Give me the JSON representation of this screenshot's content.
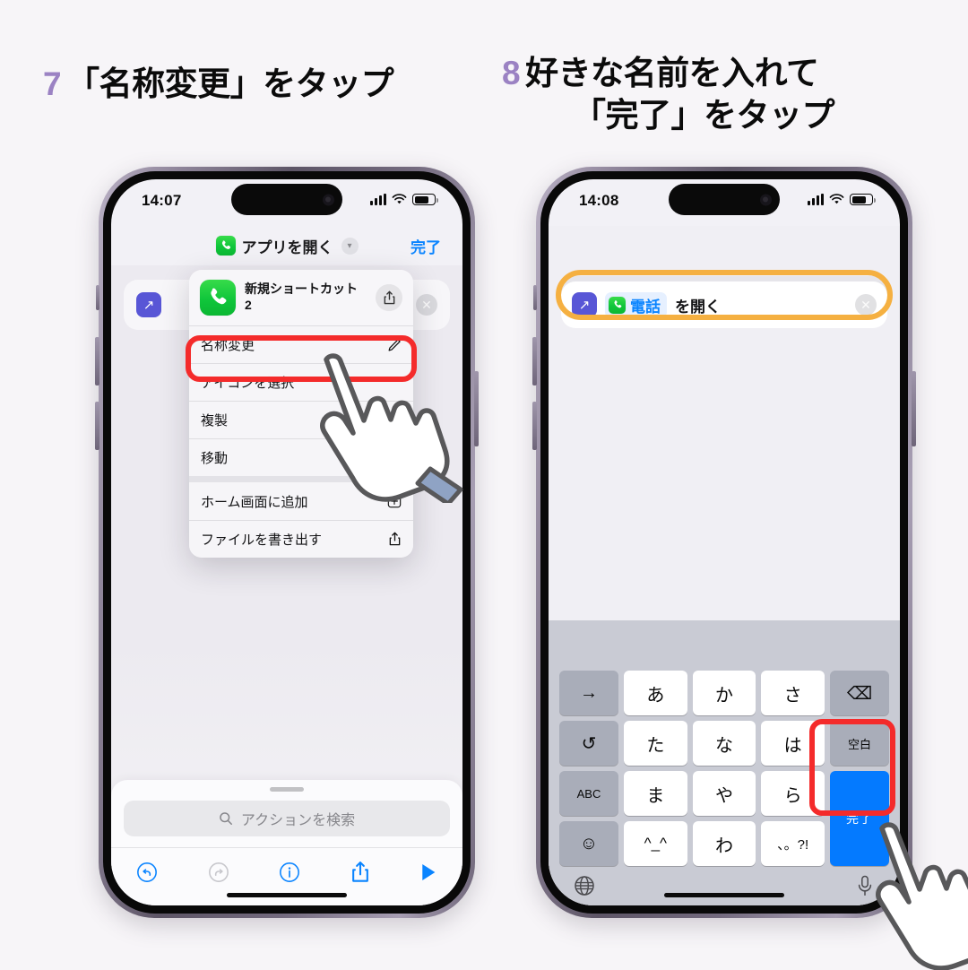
{
  "theme": {
    "background": "#f7f5f8",
    "step_number_color": "#9b82c3",
    "highlight_red": "#f42b2b",
    "highlight_orange": "#f5b041",
    "ios_blue": "#0a84ff",
    "key_done_blue": "#047aff",
    "phone_green": "#10c63b",
    "open_app_purple": "#5856d6"
  },
  "headings": {
    "left": {
      "number": "7",
      "text": "「名称変更」をタップ"
    },
    "right": {
      "number": "8",
      "line1": "好きな名前を入れて",
      "line2": "「完了」をタップ"
    }
  },
  "left_phone": {
    "status": {
      "time": "14:07",
      "signal_icon": "cellular-bars-icon",
      "wifi_icon": "wifi-icon",
      "battery_icon": "battery-icon"
    },
    "nav": {
      "app_icon": "phone-app-icon",
      "title": "アプリを開く",
      "chevron_icon": "chevron-down-icon",
      "done_label": "完了"
    },
    "action_row": {
      "open_glyph_icon": "open-app-arrow-icon",
      "close_icon": "close-circle-icon"
    },
    "context_menu": {
      "header": {
        "icon": "phone-app-icon",
        "title": "新規ショートカット 2",
        "share_icon": "share-icon"
      },
      "items": [
        {
          "label": "名称変更",
          "icon": "pencil-icon",
          "highlighted": true
        },
        {
          "label": "アイコンを選択",
          "icon": "",
          "highlighted": false
        },
        {
          "label": "複製",
          "icon": "",
          "highlighted": false
        },
        {
          "label": "移動",
          "icon": "folder-icon",
          "highlighted": false
        },
        {
          "label": "ホーム画面に追加",
          "icon": "plus-square-icon",
          "highlighted": false
        },
        {
          "label": "ファイルを書き出す",
          "icon": "share-icon",
          "highlighted": false
        }
      ],
      "separator_after_index": 3
    },
    "bottom": {
      "search_placeholder": "アクションを検索",
      "search_icon": "search-icon",
      "toolbar": [
        {
          "name": "undo-icon",
          "label": "",
          "enabled": true
        },
        {
          "name": "redo-icon",
          "label": "",
          "enabled": false
        },
        {
          "name": "info-icon",
          "label": "",
          "enabled": true
        },
        {
          "name": "share-icon",
          "label": "",
          "enabled": true
        },
        {
          "name": "play-icon",
          "label": "",
          "enabled": true
        }
      ]
    }
  },
  "right_phone": {
    "status": {
      "time": "14:08",
      "signal_icon": "cellular-bars-icon",
      "wifi_icon": "wifi-icon",
      "battery_icon": "battery-icon"
    },
    "name_field": {
      "app_icon": "phone-app-icon",
      "value": "電話",
      "clear_icon": "clear-circle-icon",
      "highlighted": true
    },
    "action_row": {
      "open_glyph_icon": "open-app-arrow-icon",
      "token_icon": "phone-app-icon",
      "token_label": "電話",
      "suffix": "を開く",
      "close_icon": "close-circle-icon"
    },
    "keyboard": {
      "rows": [
        [
          {
            "label": "→",
            "type": "fn",
            "name": "key-next-candidate"
          },
          {
            "label": "あ",
            "type": "char",
            "name": "key-a"
          },
          {
            "label": "か",
            "type": "char",
            "name": "key-ka"
          },
          {
            "label": "さ",
            "type": "char",
            "name": "key-sa"
          },
          {
            "label": "⌫",
            "type": "fn",
            "name": "key-backspace"
          }
        ],
        [
          {
            "label": "↺",
            "type": "fn",
            "name": "key-undo"
          },
          {
            "label": "た",
            "type": "char",
            "name": "key-ta"
          },
          {
            "label": "な",
            "type": "char",
            "name": "key-na"
          },
          {
            "label": "は",
            "type": "char",
            "name": "key-ha"
          },
          {
            "label": "空白",
            "type": "fn-small",
            "name": "key-space"
          }
        ],
        [
          {
            "label": "ABC",
            "type": "fn-small",
            "name": "key-abc"
          },
          {
            "label": "ま",
            "type": "char",
            "name": "key-ma"
          },
          {
            "label": "や",
            "type": "char",
            "name": "key-ya"
          },
          {
            "label": "ら",
            "type": "char",
            "name": "key-ra"
          },
          {
            "label": "完了",
            "type": "done",
            "name": "key-done"
          }
        ],
        [
          {
            "label": "☺",
            "type": "fn",
            "name": "key-emoji"
          },
          {
            "label": "^_^",
            "type": "char",
            "name": "key-kaomoji"
          },
          {
            "label": "わ",
            "type": "char",
            "name": "key-wa"
          },
          {
            "label": "、。?!",
            "type": "char-small",
            "name": "key-punctuation"
          }
        ]
      ],
      "globe_icon": "globe-icon",
      "mic_icon": "microphone-icon"
    }
  },
  "cursors": [
    {
      "name": "hand-cursor-rename",
      "target": "名称変更"
    },
    {
      "name": "hand-cursor-done-key",
      "target": "完了"
    }
  ]
}
